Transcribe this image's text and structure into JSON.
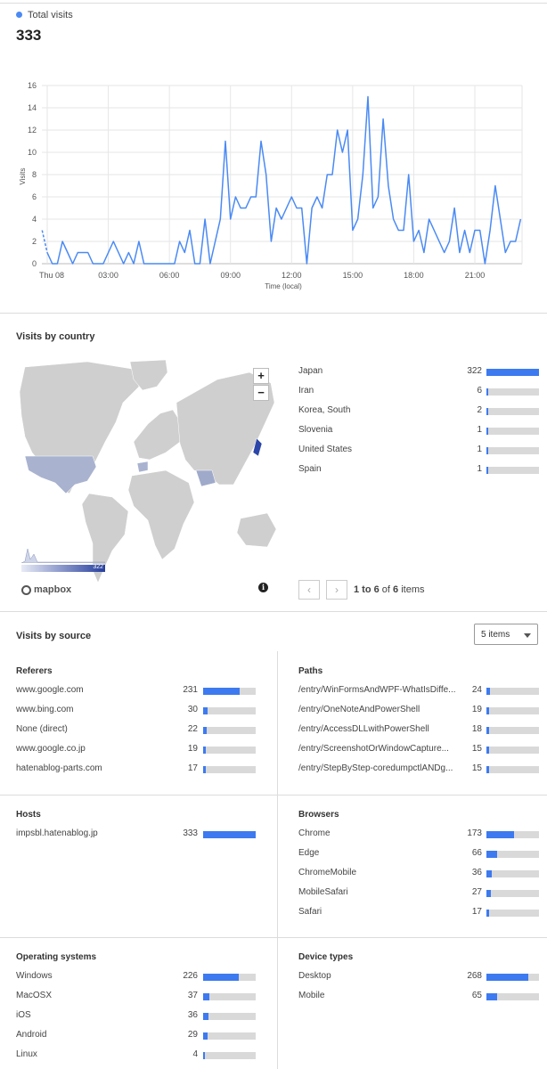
{
  "total": {
    "legend_label": "Total visits",
    "value": "333"
  },
  "colors": {
    "accent": "#3d7af0",
    "line": "#4a8af4",
    "bar_bg": "#d9d9d9"
  },
  "chart_data": {
    "type": "line",
    "title": "",
    "xlabel": "Time (local)",
    "ylabel": "Visits",
    "ylim": [
      0,
      16
    ],
    "y_ticks": [
      "0",
      "2",
      "4",
      "6",
      "8",
      "10",
      "12",
      "14",
      "16"
    ],
    "x_ticks": [
      "Thu 08",
      "03:00",
      "06:00",
      "09:00",
      "12:00",
      "15:00",
      "18:00",
      "21:00"
    ],
    "x_tick_hours": [
      0,
      3,
      6,
      9,
      12,
      15,
      18,
      21
    ],
    "grid": true,
    "series": [
      {
        "hours": [
          -0.25,
          0,
          0.25,
          0.5,
          0.75,
          1,
          1.25,
          1.5,
          1.75,
          2,
          2.25,
          2.5,
          2.75,
          3,
          3.25,
          3.5,
          3.75,
          4,
          4.25,
          4.5,
          4.75,
          5,
          5.25,
          5.5,
          5.75,
          6,
          6.25,
          6.5,
          6.75,
          7,
          7.25,
          7.5,
          7.75,
          8,
          8.25,
          8.5,
          8.75,
          9,
          9.25,
          9.5,
          9.75,
          10,
          10.25,
          10.5,
          10.75,
          11,
          11.25,
          11.5,
          11.75,
          12,
          12.25,
          12.5,
          12.75,
          13,
          13.25,
          13.5,
          13.75,
          14,
          14.25,
          14.5,
          14.75,
          15,
          15.25,
          15.5,
          15.75,
          16,
          16.25,
          16.5,
          16.75,
          17,
          17.25,
          17.5,
          17.75,
          18,
          18.25,
          18.5,
          18.75,
          19,
          19.25,
          19.5,
          19.75,
          20,
          20.25,
          20.5,
          20.75,
          21,
          21.25,
          21.5,
          21.75,
          22,
          22.25,
          22.5,
          22.75,
          23,
          23.25
        ],
        "values": [
          3,
          1,
          0,
          0,
          2,
          1,
          0,
          1,
          1,
          1,
          0,
          0,
          0,
          1,
          2,
          1,
          0,
          1,
          0,
          2,
          0,
          0,
          0,
          0,
          0,
          0,
          0,
          2,
          1,
          3,
          0,
          0,
          4,
          0,
          2,
          4,
          11,
          4,
          6,
          5,
          5,
          6,
          6,
          11,
          8,
          2,
          5,
          4,
          5,
          6,
          5,
          5,
          0,
          5,
          6,
          5,
          8,
          8,
          12,
          10,
          12,
          3,
          4,
          8,
          15,
          5,
          6,
          13,
          7,
          4,
          3,
          3,
          8,
          2,
          3,
          1,
          4,
          3,
          2,
          1,
          2,
          5,
          1,
          3,
          1,
          3,
          3,
          0,
          3,
          7,
          4,
          1,
          2,
          2,
          4,
          2,
          2
        ]
      }
    ]
  },
  "country": {
    "title": "Visits by country",
    "max": 322,
    "items": [
      {
        "name": "Japan",
        "value": 322
      },
      {
        "name": "Iran",
        "value": 6
      },
      {
        "name": "Korea, South",
        "value": 2
      },
      {
        "name": "Slovenia",
        "value": 1
      },
      {
        "name": "United States",
        "value": 1
      },
      {
        "name": "Spain",
        "value": 1
      }
    ],
    "map_scale_max": "322",
    "map_logo": "mapbox",
    "zoom_in": "+",
    "zoom_out": "−",
    "info_icon": "i",
    "pager": {
      "prev": "‹",
      "next": "›",
      "range": "1 to 6",
      "of": "of",
      "total": "6",
      "items": "items"
    }
  },
  "source": {
    "title": "Visits by source",
    "select_value": "5 items",
    "referers": {
      "title": "Referers",
      "max": 333,
      "items": [
        {
          "name": "www.google.com",
          "value": 231
        },
        {
          "name": "www.bing.com",
          "value": 30
        },
        {
          "name": "None (direct)",
          "value": 22
        },
        {
          "name": "www.google.co.jp",
          "value": 19
        },
        {
          "name": "hatenablog-parts.com",
          "value": 17
        }
      ]
    },
    "paths": {
      "title": "Paths",
      "max": 333,
      "items": [
        {
          "name": "/entry/WinFormsAndWPF-WhatIsDiffe...",
          "value": 24
        },
        {
          "name": "/entry/OneNoteAndPowerShell",
          "value": 19
        },
        {
          "name": "/entry/AccessDLLwithPowerShell",
          "value": 18
        },
        {
          "name": "/entry/ScreenshotOrWindowCapture...",
          "value": 15
        },
        {
          "name": "/entry/StepByStep-coredumpctlANDg...",
          "value": 15
        }
      ]
    },
    "hosts": {
      "title": "Hosts",
      "max": 333,
      "items": [
        {
          "name": "impsbl.hatenablog.jp",
          "value": 333
        }
      ]
    },
    "browsers": {
      "title": "Browsers",
      "max": 333,
      "items": [
        {
          "name": "Chrome",
          "value": 173
        },
        {
          "name": "Edge",
          "value": 66
        },
        {
          "name": "ChromeMobile",
          "value": 36
        },
        {
          "name": "MobileSafari",
          "value": 27
        },
        {
          "name": "Safari",
          "value": 17
        }
      ]
    },
    "os": {
      "title": "Operating systems",
      "max": 333,
      "items": [
        {
          "name": "Windows",
          "value": 226
        },
        {
          "name": "MacOSX",
          "value": 37
        },
        {
          "name": "iOS",
          "value": 36
        },
        {
          "name": "Android",
          "value": 29
        },
        {
          "name": "Linux",
          "value": 4
        }
      ]
    },
    "devices": {
      "title": "Device types",
      "max": 333,
      "items": [
        {
          "name": "Desktop",
          "value": 268
        },
        {
          "name": "Mobile",
          "value": 65
        }
      ]
    }
  }
}
